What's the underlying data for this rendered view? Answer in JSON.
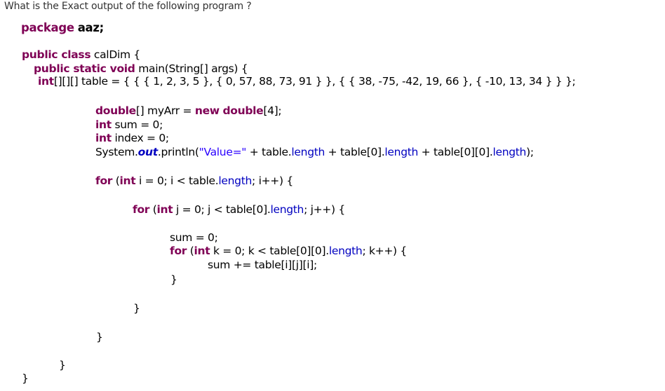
{
  "question": "What is the Exact output of the following program ?",
  "code": {
    "package_kw": "package",
    "package_name": "aaz;",
    "class_kw": "public class",
    "class_name": "calDim {",
    "method_kw": "public static void",
    "method_sig": "main(String[] args) {",
    "table_kw": "int",
    "table_decl": "[][][] table = { { { 1, 2, 3, 5 }, { 0, 57, 88, 73, 91 } }, { { 38, -75, -42, 19, 66 }, { -10, 13, 34 } } };",
    "double_kw": "double",
    "double_mid": "[] myArr = ",
    "new_kw": "new",
    "double_kw2": "double",
    "double_end": "[4];",
    "sum_kw": "int",
    "sum_decl": " sum = 0;",
    "index_kw": "int",
    "index_decl": " index = 0;",
    "println_prefix": "System.",
    "println_out": "out",
    "println_mid": ".println(",
    "println_str": "\"Value=\"",
    "println_p1": " + table.",
    "println_len1": "length",
    "println_p2": " + table[0].",
    "println_len2": "length",
    "println_p3": " + table[0][0].",
    "println_len3": "length",
    "println_end": ");",
    "for_i_kw": "for",
    "for_i_int": "int",
    "for_i_a": " i = 0; i < table.",
    "for_i_len": "length",
    "for_i_b": "; i++) {",
    "for_j_kw": "for",
    "for_j_int": "int",
    "for_j_a": " j = 0; j < table[0].",
    "for_j_len": "length",
    "for_j_b": "; j++) {",
    "sum_reset": "sum = 0;",
    "for_k_kw": "for",
    "for_k_int": "int",
    "for_k_a": " k = 0; k < table[0][0].",
    "for_k_len": "length",
    "for_k_b": "; k++) {",
    "sum_add": "sum += table[i][j][i];",
    "close_brace": "}",
    "open_paren": " ("
  },
  "colors": {
    "keyword": "#7f0055",
    "field": "#0000c0",
    "string": "#2a00ff",
    "text": "#333333"
  }
}
